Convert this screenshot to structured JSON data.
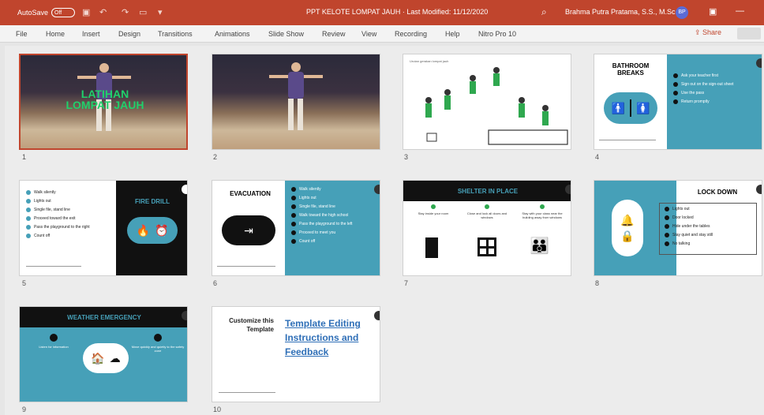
{
  "titlebar": {
    "autosave_label": "AutoSave",
    "autosave_state": "Off",
    "doc_title": "PPT KELOTE LOMPAT JAUH · Last Modified: 11/12/2020",
    "user_name": "Brahma Putra Pratama, S.S., M.Sc.",
    "user_initials": "BP"
  },
  "ribbon": {
    "tabs": [
      "File",
      "Home",
      "Insert",
      "Design",
      "Transitions",
      "Animations",
      "Slide Show",
      "Review",
      "View",
      "Recording",
      "Help",
      "Nitro Pro 10"
    ],
    "share_label": "Share"
  },
  "slides": [
    {
      "number": "1",
      "overlay": "LATIHAN LOMPAT JAUH"
    },
    {
      "number": "2"
    },
    {
      "number": "3",
      "caption": "Urutan gerakan lompat jauh"
    },
    {
      "number": "4",
      "title": "BATHROOM BREAKS",
      "bullets": [
        "Ask your teacher first",
        "Sign out on the sign-out sheet",
        "Use the pass",
        "Return promptly"
      ]
    },
    {
      "number": "5",
      "title": "FIRE DRILL",
      "bullets": [
        "Walk silently",
        "Lights out",
        "Single file, stand line",
        "Proceed toward the exit",
        "Pass the playground to the right",
        "Count off"
      ]
    },
    {
      "number": "6",
      "title": "EVACUATION",
      "bullets": [
        "Walk silently",
        "Lights out",
        "Single file, stand line",
        "Walk toward the high school",
        "Pass the playground to the left",
        "Proceed to meet you",
        "Count off"
      ]
    },
    {
      "number": "7",
      "title": "SHELTER IN PLACE",
      "columns": [
        "Stay inside your room",
        "Close and lock all doors and windows",
        "Stay with your class near the building away from windows"
      ]
    },
    {
      "number": "8",
      "title": "LOCK DOWN",
      "bullets": [
        "Lights out",
        "Door locked",
        "Hide under the tables",
        "Stay quiet and stay still",
        "No talking"
      ]
    },
    {
      "number": "9",
      "title": "WEATHER EMERGENCY",
      "columns": [
        "Listen for information",
        "Move quickly and quietly to the safety zone"
      ]
    },
    {
      "number": "10",
      "side_text": "Customize this Template",
      "link": "Template Editing Instructions and Feedback"
    }
  ],
  "colors": {
    "accent": "#46a0b8",
    "titlebar": "#c0452d",
    "link": "#2f6fb7"
  },
  "icons": {
    "search": "search-icon",
    "restroom": "restroom-icon",
    "fire": "fire-icon",
    "exit": "exit-icon",
    "door": "door-icon",
    "window": "window-icon",
    "family": "family-icon",
    "lock": "lock-icon",
    "house": "house-icon"
  }
}
